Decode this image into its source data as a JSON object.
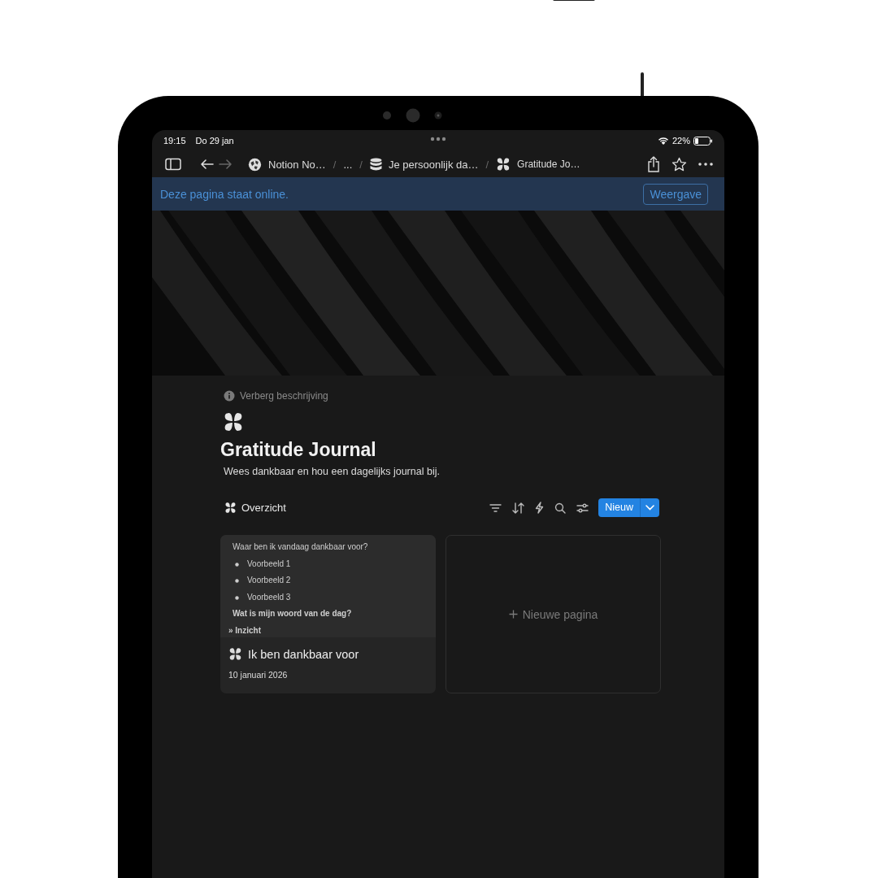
{
  "status_bar": {
    "time": "19:15",
    "date": "Do 29 jan",
    "battery": "22%"
  },
  "toolbar": {
    "nav": [
      {
        "kind": "back",
        "disabled": false
      },
      {
        "kind": "forward",
        "disabled": true
      }
    ],
    "breadcrumbs": [
      {
        "kind": "workspace",
        "label": "Notion No…"
      },
      {
        "kind": "separator",
        "label": "/"
      },
      {
        "kind": "ellipsis",
        "label": "..."
      },
      {
        "kind": "separator",
        "label": "/"
      },
      {
        "kind": "database",
        "label": "Je persoonlijk da…"
      },
      {
        "kind": "separator",
        "label": "/"
      },
      {
        "kind": "page",
        "label": "Gratitude Jo…"
      }
    ]
  },
  "banner": {
    "text": "Deze pagina staat online.",
    "button": "Weergave"
  },
  "page": {
    "hint": "Verberg beschrijving",
    "title": "Gratitude Journal",
    "description": "Wees dankbaar en hou een dagelijks journal bij."
  },
  "view": {
    "name": "Overzicht",
    "new_button": "Nieuw"
  },
  "cards": [
    {
      "kind": "page",
      "preview": [
        {
          "kind": "text",
          "text": "Waar ben ik vandaag dankbaar voor?"
        },
        {
          "kind": "bullet",
          "text": "Voorbeeld 1"
        },
        {
          "kind": "bullet",
          "text": "Voorbeeld 2"
        },
        {
          "kind": "bullet",
          "text": "Voorbeeld 3"
        },
        {
          "kind": "bold",
          "text": "Wat is mijn woord van de dag?"
        },
        {
          "kind": "toggle",
          "text": "» Inzicht"
        }
      ],
      "title": "Ik ben dankbaar voor",
      "date": "10 januari 2026"
    },
    {
      "kind": "new",
      "label": "Nieuwe pagina"
    }
  ]
}
